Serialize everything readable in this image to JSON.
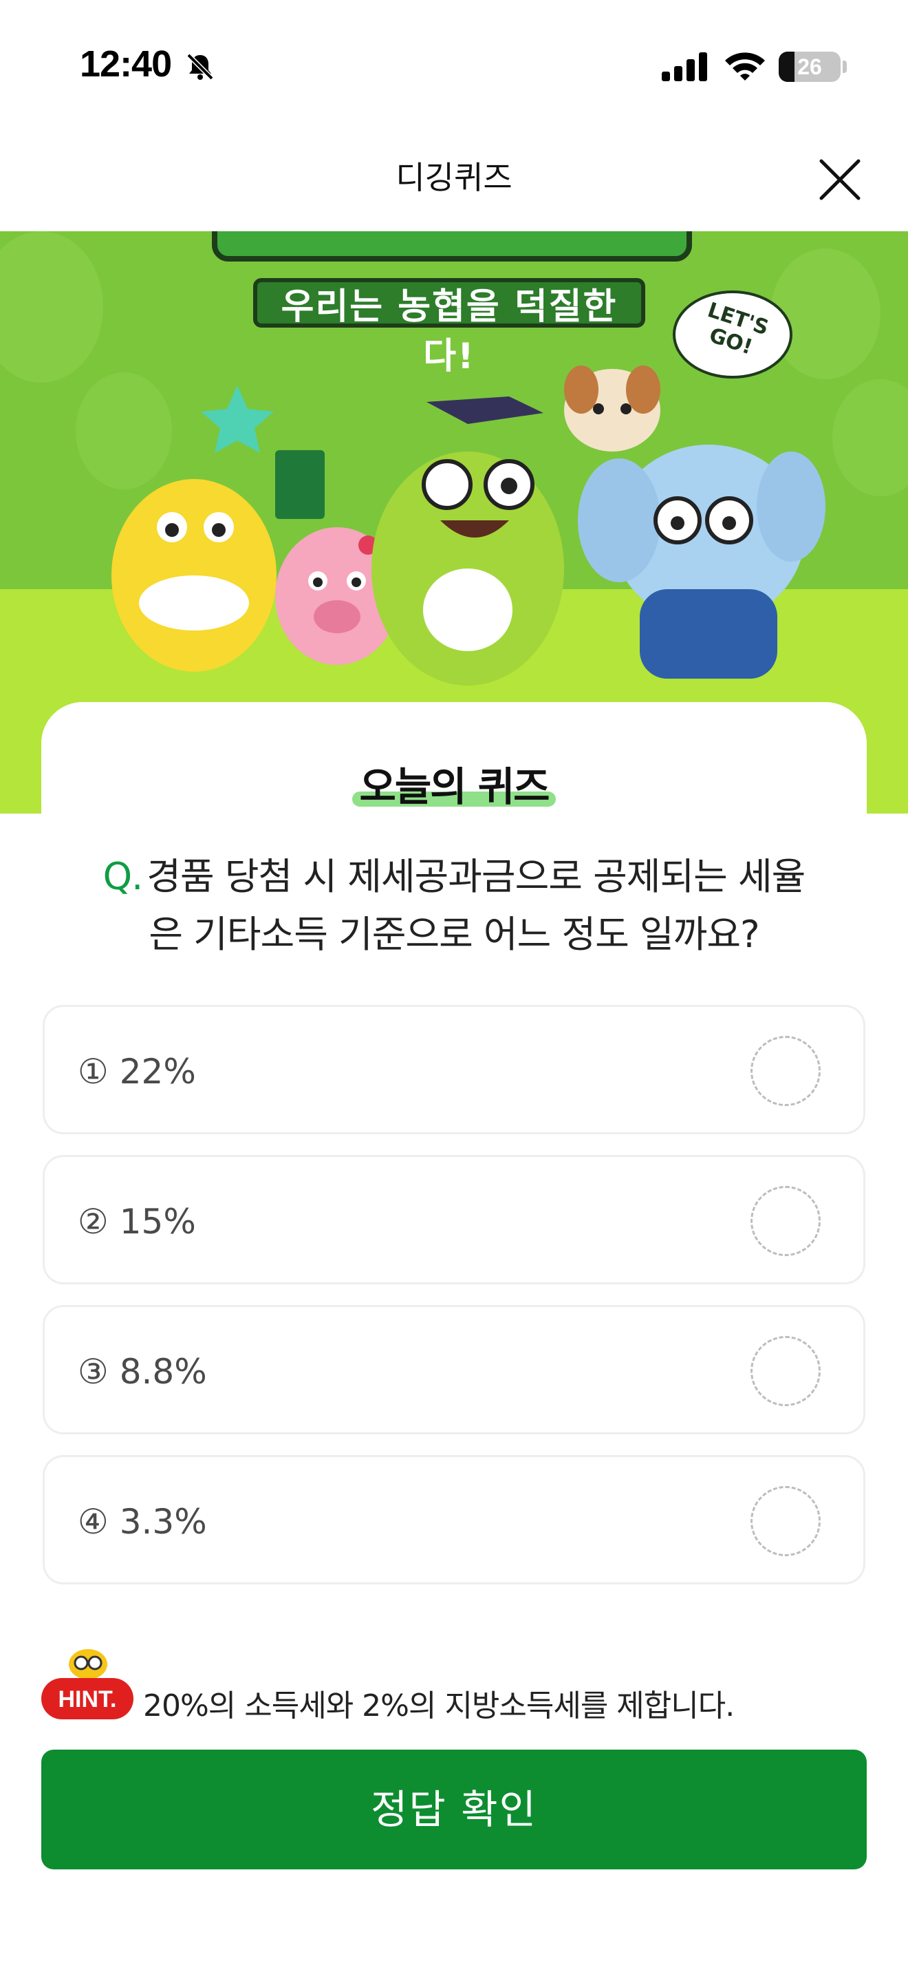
{
  "status_bar": {
    "time": "12:40",
    "battery_level": "26",
    "battery_percent": 26,
    "icons": [
      "bell-slash-icon",
      "cellular-signal-icon",
      "wifi-icon",
      "battery-icon"
    ]
  },
  "header": {
    "title": "디깅퀴즈",
    "close_icon": "close-icon"
  },
  "banner": {
    "tagline": "우리는 농협을 덕질한다!",
    "speech_bubble": "LET'S GO!",
    "colors": {
      "top": "#7cc63c",
      "bottom": "#b3e53a"
    }
  },
  "quiz": {
    "section_title": "오늘의 퀴즈",
    "question_prefix": "Q.",
    "question_line1": "경품 당첨 시 제세공과금으로 공제되는 세율",
    "question_line2": "은 기타소득 기준으로 어느 정도 일까요?",
    "options": [
      {
        "label": "① 22%"
      },
      {
        "label": "② 15%"
      },
      {
        "label": "③ 8.8%"
      },
      {
        "label": "④ 3.3%"
      }
    ],
    "hint_badge": "HINT.",
    "hint_text": "20%의 소득세와 2%의 지방소득세를 제합니다.",
    "submit_label": "정답 확인",
    "accent_color": "#0d8d30"
  }
}
